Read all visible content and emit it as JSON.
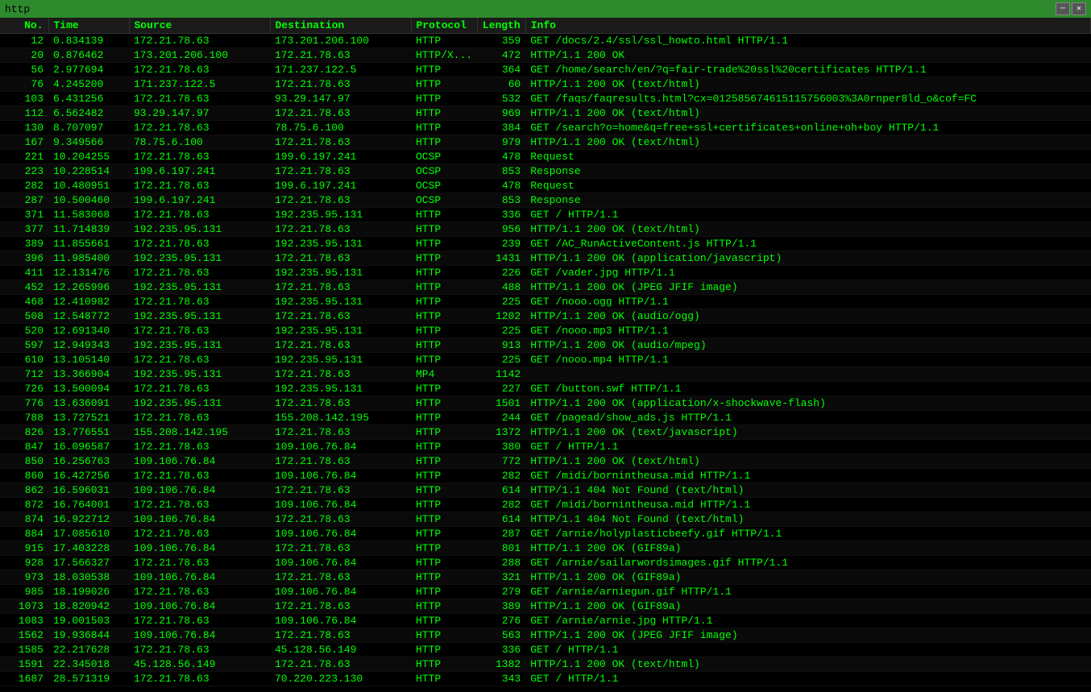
{
  "titleBar": {
    "title": "http",
    "closeBtn": "✕",
    "minBtn": "─"
  },
  "columns": [
    "No.",
    "Time",
    "Source",
    "Destination",
    "Protocol",
    "Length",
    "Info"
  ],
  "rows": [
    {
      "no": "12",
      "time": "0.834139",
      "src": "172.21.78.63",
      "dst": "173.201.206.100",
      "proto": "HTTP",
      "len": "359",
      "info": "GET /docs/2.4/ssl/ssl_howto.html HTTP/1.1"
    },
    {
      "no": "20",
      "time": "0.876462",
      "src": "173.201.206.100",
      "dst": "172.21.78.63",
      "proto": "HTTP/X...",
      "len": "472",
      "info": "HTTP/1.1 200 OK"
    },
    {
      "no": "56",
      "time": "2.977694",
      "src": "172.21.78.63",
      "dst": "171.237.122.5",
      "proto": "HTTP",
      "len": "364",
      "info": "GET /home/search/en/?q=fair-trade%20ssl%20certificates HTTP/1.1"
    },
    {
      "no": "76",
      "time": "4.245200",
      "src": "171.237.122.5",
      "dst": "172.21.78.63",
      "proto": "HTTP",
      "len": "60",
      "info": "HTTP/1.1 200 OK  (text/html)"
    },
    {
      "no": "103",
      "time": "6.431256",
      "src": "172.21.78.63",
      "dst": "93.29.147.97",
      "proto": "HTTP",
      "len": "532",
      "info": "GET /faqs/faqresults.html?cx=012585674615115756003%3A0rnper8ld_o&cof=FC"
    },
    {
      "no": "112",
      "time": "6.562482",
      "src": "93.29.147.97",
      "dst": "172.21.78.63",
      "proto": "HTTP",
      "len": "969",
      "info": "HTTP/1.1 200 OK  (text/html)"
    },
    {
      "no": "130",
      "time": "8.707097",
      "src": "172.21.78.63",
      "dst": "78.75.6.100",
      "proto": "HTTP",
      "len": "384",
      "info": "GET /search?o=home&q=free+ssl+certificates+online+oh+boy HTTP/1.1"
    },
    {
      "no": "167",
      "time": "9.349566",
      "src": "78.75.6.100",
      "dst": "172.21.78.63",
      "proto": "HTTP",
      "len": "979",
      "info": "HTTP/1.1 200 OK  (text/html)"
    },
    {
      "no": "221",
      "time": "10.204255",
      "src": "172.21.78.63",
      "dst": "199.6.197.241",
      "proto": "OCSP",
      "len": "478",
      "info": "Request"
    },
    {
      "no": "223",
      "time": "10.228514",
      "src": "199.6.197.241",
      "dst": "172.21.78.63",
      "proto": "OCSP",
      "len": "853",
      "info": "Response"
    },
    {
      "no": "282",
      "time": "10.480951",
      "src": "172.21.78.63",
      "dst": "199.6.197.241",
      "proto": "OCSP",
      "len": "478",
      "info": "Request"
    },
    {
      "no": "287",
      "time": "10.500460",
      "src": "199.6.197.241",
      "dst": "172.21.78.63",
      "proto": "OCSP",
      "len": "853",
      "info": "Response"
    },
    {
      "no": "371",
      "time": "11.583068",
      "src": "172.21.78.63",
      "dst": "192.235.95.131",
      "proto": "HTTP",
      "len": "336",
      "info": "GET / HTTP/1.1"
    },
    {
      "no": "377",
      "time": "11.714839",
      "src": "192.235.95.131",
      "dst": "172.21.78.63",
      "proto": "HTTP",
      "len": "956",
      "info": "HTTP/1.1 200 OK  (text/html)"
    },
    {
      "no": "389",
      "time": "11.855661",
      "src": "172.21.78.63",
      "dst": "192.235.95.131",
      "proto": "HTTP",
      "len": "239",
      "info": "GET /AC_RunActiveContent.js HTTP/1.1"
    },
    {
      "no": "396",
      "time": "11.985400",
      "src": "192.235.95.131",
      "dst": "172.21.78.63",
      "proto": "HTTP",
      "len": "1431",
      "info": "HTTP/1.1 200 OK  (application/javascript)"
    },
    {
      "no": "411",
      "time": "12.131476",
      "src": "172.21.78.63",
      "dst": "192.235.95.131",
      "proto": "HTTP",
      "len": "226",
      "info": "GET /vader.jpg HTTP/1.1"
    },
    {
      "no": "452",
      "time": "12.265996",
      "src": "192.235.95.131",
      "dst": "172.21.78.63",
      "proto": "HTTP",
      "len": "488",
      "info": "HTTP/1.1 200 OK  (JPEG JFIF image)"
    },
    {
      "no": "468",
      "time": "12.410982",
      "src": "172.21.78.63",
      "dst": "192.235.95.131",
      "proto": "HTTP",
      "len": "225",
      "info": "GET /nooo.ogg HTTP/1.1"
    },
    {
      "no": "508",
      "time": "12.548772",
      "src": "192.235.95.131",
      "dst": "172.21.78.63",
      "proto": "HTTP",
      "len": "1202",
      "info": "HTTP/1.1 200 OK  (audio/ogg)"
    },
    {
      "no": "520",
      "time": "12.691340",
      "src": "172.21.78.63",
      "dst": "192.235.95.131",
      "proto": "HTTP",
      "len": "225",
      "info": "GET /nooo.mp3 HTTP/1.1"
    },
    {
      "no": "597",
      "time": "12.949343",
      "src": "192.235.95.131",
      "dst": "172.21.78.63",
      "proto": "HTTP",
      "len": "913",
      "info": "HTTP/1.1 200 OK  (audio/mpeg)"
    },
    {
      "no": "610",
      "time": "13.105140",
      "src": "172.21.78.63",
      "dst": "192.235.95.131",
      "proto": "HTTP",
      "len": "225",
      "info": "GET /nooo.mp4 HTTP/1.1"
    },
    {
      "no": "712",
      "time": "13.366904",
      "src": "192.235.95.131",
      "dst": "172.21.78.63",
      "proto": "MP4",
      "len": "1142",
      "info": ""
    },
    {
      "no": "726",
      "time": "13.500094",
      "src": "172.21.78.63",
      "dst": "192.235.95.131",
      "proto": "HTTP",
      "len": "227",
      "info": "GET /button.swf HTTP/1.1"
    },
    {
      "no": "776",
      "time": "13.636091",
      "src": "192.235.95.131",
      "dst": "172.21.78.63",
      "proto": "HTTP",
      "len": "1501",
      "info": "HTTP/1.1 200 OK  (application/x-shockwave-flash)"
    },
    {
      "no": "788",
      "time": "13.727521",
      "src": "172.21.78.63",
      "dst": "155.208.142.195",
      "proto": "HTTP",
      "len": "244",
      "info": "GET /pagead/show_ads.js HTTP/1.1"
    },
    {
      "no": "826",
      "time": "13.776551",
      "src": "155.208.142.195",
      "dst": "172.21.78.63",
      "proto": "HTTP",
      "len": "1372",
      "info": "HTTP/1.1 200 OK  (text/javascript)"
    },
    {
      "no": "847",
      "time": "16.096587",
      "src": "172.21.78.63",
      "dst": "109.106.76.84",
      "proto": "HTTP",
      "len": "380",
      "info": "GET / HTTP/1.1"
    },
    {
      "no": "850",
      "time": "16.256763",
      "src": "109.106.76.84",
      "dst": "172.21.78.63",
      "proto": "HTTP",
      "len": "772",
      "info": "HTTP/1.1 200 OK  (text/html)"
    },
    {
      "no": "860",
      "time": "16.427256",
      "src": "172.21.78.63",
      "dst": "109.106.76.84",
      "proto": "HTTP",
      "len": "282",
      "info": "GET /midi/bornintheusa.mid HTTP/1.1"
    },
    {
      "no": "862",
      "time": "16.596031",
      "src": "109.106.76.84",
      "dst": "172.21.78.63",
      "proto": "HTTP",
      "len": "614",
      "info": "HTTP/1.1 404 Not Found  (text/html)"
    },
    {
      "no": "872",
      "time": "16.764001",
      "src": "172.21.78.63",
      "dst": "109.106.76.84",
      "proto": "HTTP",
      "len": "282",
      "info": "GET /midi/bornintheusa.mid HTTP/1.1"
    },
    {
      "no": "874",
      "time": "16.922712",
      "src": "109.106.76.84",
      "dst": "172.21.78.63",
      "proto": "HTTP",
      "len": "614",
      "info": "HTTP/1.1 404 Not Found  (text/html)"
    },
    {
      "no": "884",
      "time": "17.085610",
      "src": "172.21.78.63",
      "dst": "109.106.76.84",
      "proto": "HTTP",
      "len": "287",
      "info": "GET /arnie/holyplasticbeefy.gif HTTP/1.1"
    },
    {
      "no": "915",
      "time": "17.403228",
      "src": "109.106.76.84",
      "dst": "172.21.78.63",
      "proto": "HTTP",
      "len": "801",
      "info": "HTTP/1.1 200 OK  (GIF89a)"
    },
    {
      "no": "928",
      "time": "17.566327",
      "src": "172.21.78.63",
      "dst": "109.106.76.84",
      "proto": "HTTP",
      "len": "288",
      "info": "GET /arnie/sailarwordsimages.gif HTTP/1.1"
    },
    {
      "no": "973",
      "time": "18.030538",
      "src": "109.106.76.84",
      "dst": "172.21.78.63",
      "proto": "HTTP",
      "len": "321",
      "info": "HTTP/1.1 200 OK  (GIF89a)"
    },
    {
      "no": "985",
      "time": "18.199026",
      "src": "172.21.78.63",
      "dst": "109.106.76.84",
      "proto": "HTTP",
      "len": "279",
      "info": "GET /arnie/arniegun.gif HTTP/1.1"
    },
    {
      "no": "1073",
      "time": "18.820942",
      "src": "109.106.76.84",
      "dst": "172.21.78.63",
      "proto": "HTTP",
      "len": "389",
      "info": "HTTP/1.1 200 OK  (GIF89a)"
    },
    {
      "no": "1083",
      "time": "19.001503",
      "src": "172.21.78.63",
      "dst": "109.106.76.84",
      "proto": "HTTP",
      "len": "276",
      "info": "GET /arnie/arnie.jpg HTTP/1.1"
    },
    {
      "no": "1562",
      "time": "19.936844",
      "src": "109.106.76.84",
      "dst": "172.21.78.63",
      "proto": "HTTP",
      "len": "563",
      "info": "HTTP/1.1 200 OK  (JPEG JFIF image)"
    },
    {
      "no": "1585",
      "time": "22.217628",
      "src": "172.21.78.63",
      "dst": "45.128.56.149",
      "proto": "HTTP",
      "len": "336",
      "info": "GET / HTTP/1.1"
    },
    {
      "no": "1591",
      "time": "22.345018",
      "src": "45.128.56.149",
      "dst": "172.21.78.63",
      "proto": "HTTP",
      "len": "1382",
      "info": "HTTP/1.1 200 OK  (text/html)"
    },
    {
      "no": "1687",
      "time": "28.571319",
      "src": "172.21.78.63",
      "dst": "70.220.223.130",
      "proto": "HTTP",
      "len": "343",
      "info": "GET / HTTP/1.1"
    }
  ]
}
